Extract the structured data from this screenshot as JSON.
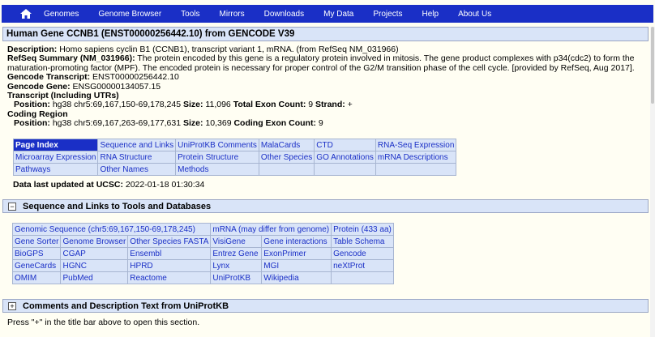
{
  "nav": {
    "home_icon": "home-icon",
    "items": [
      "Genomes",
      "Genome Browser",
      "Tools",
      "Mirrors",
      "Downloads",
      "My Data",
      "Projects",
      "Help",
      "About Us"
    ]
  },
  "gene": {
    "title": "Human Gene CCNB1 (ENST00000256442.10) from GENCODE V39",
    "description_label": "Description:",
    "description": "Homo sapiens cyclin B1 (CCNB1), transcript variant 1, mRNA. (from RefSeq NM_031966)",
    "refseq_label": "RefSeq Summary (NM_031966):",
    "refseq_text_1": "The protein encoded by this gene is a regulatory protein involved in mitosis. The gene product complexes with p34(cdc2) to form the",
    "refseq_text_2": "maturation-promoting factor (MPF). The encoded protein is necessary for proper control of the G2/M transition phase of the cell cycle. [provided by RefSeq, Aug 2017].",
    "gencode_transcript_label": "Gencode Transcript:",
    "gencode_transcript": "ENST00000256442.10",
    "gencode_gene_label": "Gencode Gene:",
    "gencode_gene": "ENSG00000134057.15",
    "transcript_label": "Transcript (Including UTRs)",
    "transcript_position_label": "Position:",
    "transcript_position": "hg38 chr5:69,167,150-69,178,245",
    "transcript_size_label": "Size:",
    "transcript_size": "11,096",
    "exon_count_label": "Total Exon Count:",
    "exon_count": "9",
    "strand_label": "Strand:",
    "strand": "+",
    "coding_label": "Coding Region",
    "coding_position_label": "Position:",
    "coding_position": "hg38 chr5:69,167,263-69,177,631",
    "coding_size_label": "Size:",
    "coding_size": "10,369",
    "coding_exon_label": "Coding Exon Count:",
    "coding_exon_count": "9"
  },
  "page_index": {
    "header": "Page Index",
    "rows": [
      [
        "Sequence and Links",
        "UniProtKB Comments",
        "MalaCards",
        "CTD",
        "RNA-Seq Expression"
      ],
      [
        "Microarray Expression",
        "RNA Structure",
        "Protein Structure",
        "Other Species",
        "GO Annotations",
        "mRNA Descriptions"
      ],
      [
        "Pathways",
        "Other Names",
        "Methods",
        "",
        "",
        ""
      ]
    ]
  },
  "updated": {
    "label": "Data last updated at UCSC:",
    "value": "2022-01-18 01:30:34"
  },
  "links_section": {
    "toggle": "−",
    "title": "Sequence and Links to Tools and Databases",
    "row0": [
      "Genomic Sequence (chr5:69,167,150-69,178,245)",
      "mRNA (may differ from genome)",
      "Protein (433 aa)"
    ],
    "rows": [
      [
        "Gene Sorter",
        "Genome Browser",
        "Other Species FASTA",
        "VisiGene",
        "Gene interactions",
        "Table Schema"
      ],
      [
        "BioGPS",
        "CGAP",
        "Ensembl",
        "Entrez Gene",
        "ExonPrimer",
        "Gencode"
      ],
      [
        "GeneCards",
        "HGNC",
        "HPRD",
        "Lynx",
        "MGI",
        "neXtProt"
      ],
      [
        "OMIM",
        "PubMed",
        "Reactome",
        "UniProtKB",
        "Wikipedia",
        ""
      ]
    ]
  },
  "comments_section": {
    "toggle": "+",
    "title": "Comments and Description Text from UniProtKB",
    "note": "Press \"+\" in the title bar above to open this section."
  }
}
